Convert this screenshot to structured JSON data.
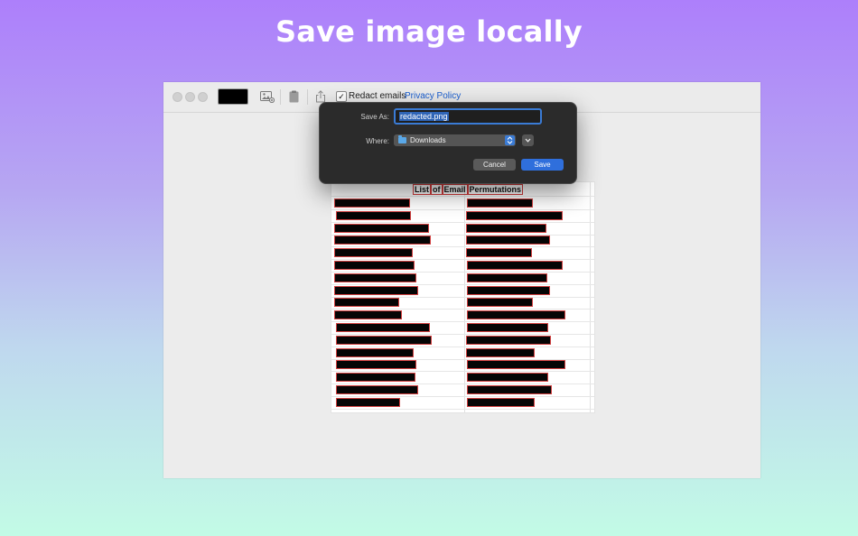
{
  "banner": {
    "title": "Save image locally"
  },
  "toolbar": {
    "redact_emails_label": "Redact emails",
    "redact_emails_checked": true,
    "privacy_policy_label": "Privacy Policy",
    "swatch_color": "#000000",
    "icons": [
      "image-icon",
      "clipboard-icon",
      "share-icon"
    ]
  },
  "sheet": {
    "header_words": [
      "List",
      "of",
      "Email",
      "Permutations"
    ]
  },
  "dialog": {
    "save_as_label": "Save As:",
    "filename_value": "redacted.png",
    "where_label": "Where:",
    "where_value": "Downloads",
    "cancel_label": "Cancel",
    "save_label": "Save",
    "accent_color": "#2f6fdc"
  }
}
